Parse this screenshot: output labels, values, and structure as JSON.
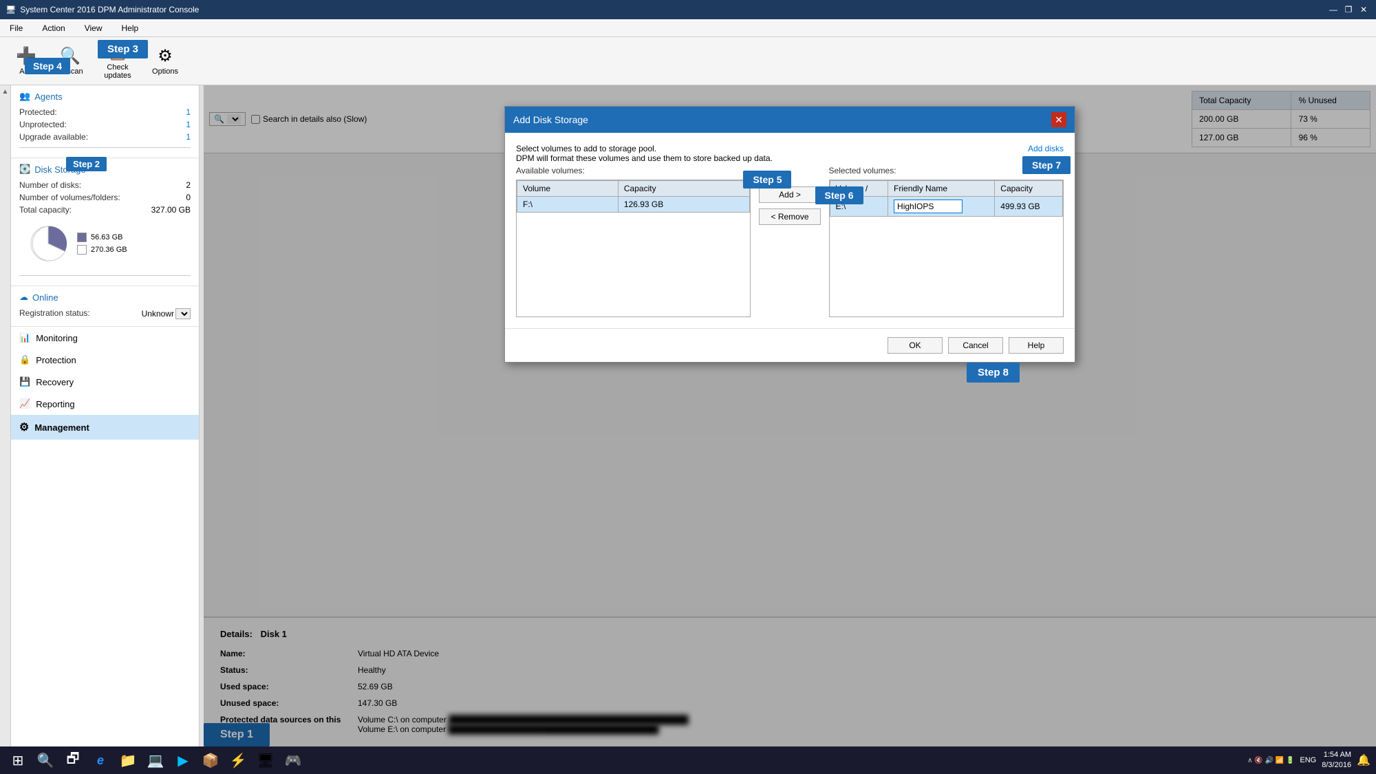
{
  "titleBar": {
    "title": "System Center 2016 DPM Administrator Console",
    "icon": "🖥",
    "controls": [
      "—",
      "❐",
      "✕"
    ]
  },
  "menuBar": {
    "items": [
      "File",
      "Action",
      "View",
      "Help"
    ]
  },
  "toolbar": {
    "buttons": [
      {
        "label": "Add",
        "icon": "➕"
      },
      {
        "label": "Rescan",
        "icon": "🔍"
      },
      {
        "label": "Check updates",
        "icon": "📋"
      },
      {
        "label": "Options",
        "icon": "⚙"
      }
    ],
    "step3Label": "Step 3",
    "step4Label": "Step 4"
  },
  "sidebar": {
    "agentsTitle": "Agents",
    "protectedLabel": "Protected:",
    "protectedValue": "1",
    "unprotectedLabel": "Unprotected:",
    "unprotectedValue": "1",
    "upgradeLabel": "Upgrade available:",
    "upgradeValue": "1",
    "diskStorageTitle": "Disk Storage",
    "step2Label": "Step 2",
    "numDisksLabel": "Number of disks:",
    "numDisksValue": "2",
    "numVolumesLabel": "Number of volumes/folders:",
    "numVolumesValue": "0",
    "totalCapacityLabel": "Total capacity:",
    "totalCapacityValue": "327.00 GB",
    "legend": [
      {
        "color": "#6c6c9c",
        "label": "56.63 GB"
      },
      {
        "color": "white",
        "label": "270.36 GB"
      }
    ],
    "onlineTitle": "Online",
    "regStatusLabel": "Registration status:",
    "regStatusValue": "Unknowr",
    "navItems": [
      {
        "icon": "📊",
        "label": "Monitoring"
      },
      {
        "icon": "🔒",
        "label": "Protection"
      },
      {
        "icon": "💾",
        "label": "Recovery"
      },
      {
        "icon": "📈",
        "label": "Reporting"
      },
      {
        "icon": "⚙",
        "label": "Management",
        "active": true
      }
    ]
  },
  "rightPanel": {
    "searchPlaceholder": "",
    "searchLabel": "Search in details also (Slow)",
    "tableHeaders": [
      "Total Capacity",
      "% Unused"
    ],
    "tableRows": [
      {
        "capacity": "200.00 GB",
        "unused": "73 %"
      },
      {
        "capacity": "127.00 GB",
        "unused": "96 %"
      }
    ],
    "capacityHeader": "Capacity",
    "unusedHeader": "Unused"
  },
  "details": {
    "title": "Details:",
    "diskLabel": "Disk 1",
    "nameLabel": "Name:",
    "nameValue": "Virtual HD ATA Device",
    "statusLabel": "Status:",
    "statusValue": "Healthy",
    "usedSpaceLabel": "Used space:",
    "usedSpaceValue": "52.69 GB",
    "unusedSpaceLabel": "Unused space:",
    "unusedSpaceValue": "147.30 GB",
    "protectedLabel": "Protected data sources on this disk:",
    "protectedValue1": "Volume C:\\ on computer",
    "protectedValue2": "Volume E:\\ on computer"
  },
  "dialog": {
    "title": "Add Disk Storage",
    "description": "Select volumes to add to storage pool.",
    "description2": "DPM will format these volumes and use them to store backed up data.",
    "addDisksLink": "Add disks",
    "availableVolumesLabel": "Available volumes:",
    "selectedVolumesLabel": "Selected volumes:",
    "availableTable": {
      "headers": [
        "Volume",
        "Capacity"
      ],
      "rows": [
        {
          "volume": "F:\\",
          "capacity": "126.93 GB"
        }
      ]
    },
    "selectedTable": {
      "headers": [
        "Volume  /",
        "Friendly Name",
        "Capacity"
      ],
      "rows": [
        {
          "volume": "E:\\",
          "friendlyName": "HighIOPS",
          "capacity": "499.93 GB"
        }
      ]
    },
    "addBtn": "Add >",
    "removeBtn": "< Remove",
    "okBtn": "OK",
    "cancelBtn": "Cancel",
    "helpBtn": "Help",
    "step5Label": "Step 5",
    "step6Label": "Step 6",
    "step7Label": "Step 7",
    "step8Label": "Step 8"
  },
  "bottomStep": {
    "label": "Step 1"
  },
  "taskbar": {
    "icons": [
      "⊞",
      "🔍",
      "🗗",
      "e",
      "📁",
      "💻",
      "🔷",
      "📦",
      "⚡",
      "🖥",
      "🎮"
    ],
    "time": "1:54 AM",
    "date": "8/3/2016",
    "lang": "ENG"
  }
}
